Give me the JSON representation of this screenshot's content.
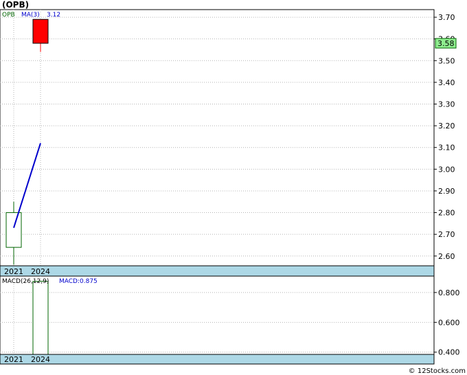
{
  "title": "(OPB)",
  "footer": "© 12Stocks.com",
  "price_panel": {
    "symbol_label": "OPB",
    "ma_label": "MA(3)",
    "ma_value": "3.12",
    "last_price_tag": "3.58",
    "x_labels": [
      "2021",
      "2024"
    ]
  },
  "macd_panel": {
    "label": "MACD(26,12,9)",
    "value_label": "MACD:0.875",
    "x_labels": [
      "2021",
      "2024"
    ]
  },
  "colors": {
    "up": "#006400",
    "down": "#ff0000",
    "ma_line": "#0000cc",
    "axis_band": "#add8e6",
    "grid": "#b4b4b4",
    "price_tag_bg": "#90ee90"
  },
  "chart_data": [
    {
      "type": "candlestick",
      "title": "(OPB)",
      "categories": [
        "2021",
        "2024"
      ],
      "ohlc": [
        {
          "x": "2021",
          "open": 2.64,
          "high": 2.85,
          "low": 2.56,
          "close": 2.8
        },
        {
          "x": "2024",
          "open": 3.69,
          "high": 3.69,
          "low": 3.54,
          "close": 3.58
        }
      ],
      "series": [
        {
          "name": "MA(3)",
          "values": [
            2.73,
            3.12
          ]
        }
      ],
      "ylim": [
        2.555,
        3.735
      ],
      "yticks": [
        2.6,
        2.7,
        2.8,
        2.9,
        3.0,
        3.1,
        3.2,
        3.3,
        3.4,
        3.5,
        3.6,
        3.7
      ],
      "ytick_labels": [
        "2.60",
        "2.70",
        "2.80",
        "2.90",
        "3.00",
        "3.10",
        "3.20",
        "3.30",
        "3.40",
        "3.50",
        "3.60",
        "3.70"
      ],
      "grid": true
    },
    {
      "type": "bar",
      "title": "MACD(26,12,9)",
      "categories": [
        "2021",
        "2024"
      ],
      "series": [
        {
          "name": "MACD",
          "values": [
            null,
            0.875
          ]
        }
      ],
      "ylim": [
        0.385,
        0.91
      ],
      "yticks": [
        0.4,
        0.6,
        0.8
      ],
      "ytick_labels": [
        "0.400",
        "0.600",
        "0.800"
      ],
      "grid": true
    }
  ]
}
